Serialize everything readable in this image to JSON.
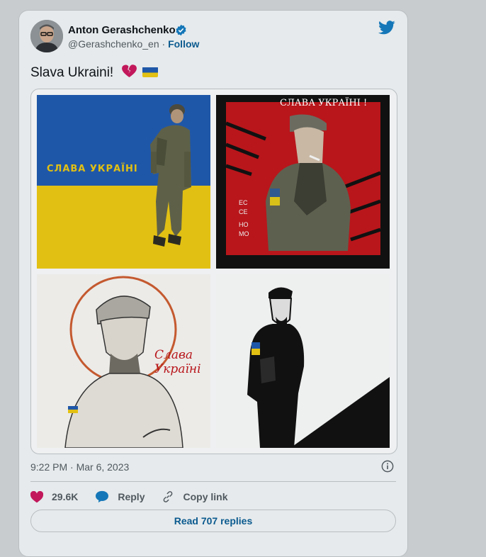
{
  "author": {
    "name": "Anton Gerashchenko",
    "handle": "@Gerashchenko_en",
    "separator": "·",
    "follow_label": "Follow"
  },
  "tweet": {
    "text": "Slava Ukraini!",
    "emojis": [
      "broken-heart-icon",
      "ukraine-flag-icon"
    ]
  },
  "media": {
    "panels": [
      {
        "caption": "СЛАВА УКРАЇНІ"
      },
      {
        "caption": "СЛАВА УКРАЇНІ !",
        "side_text": [
          "EC",
          "CE",
          "HO",
          "MO"
        ]
      },
      {
        "caption_line1": "Слава",
        "caption_line2": "Україні"
      },
      {
        "caption": ""
      }
    ]
  },
  "meta": {
    "time": "9:22 PM · Mar 6, 2023"
  },
  "actions": {
    "likes_count": "29.6K",
    "reply_label": "Reply",
    "copy_label": "Copy link"
  },
  "read_replies_label": "Read 707 replies",
  "colors": {
    "like": "#c2185b",
    "link": "#0b5a8f",
    "twitter_blue": "#1577b8",
    "flag_blue": "#1f57a8",
    "flag_yellow": "#e2c013",
    "poster_red": "#b8161b"
  }
}
